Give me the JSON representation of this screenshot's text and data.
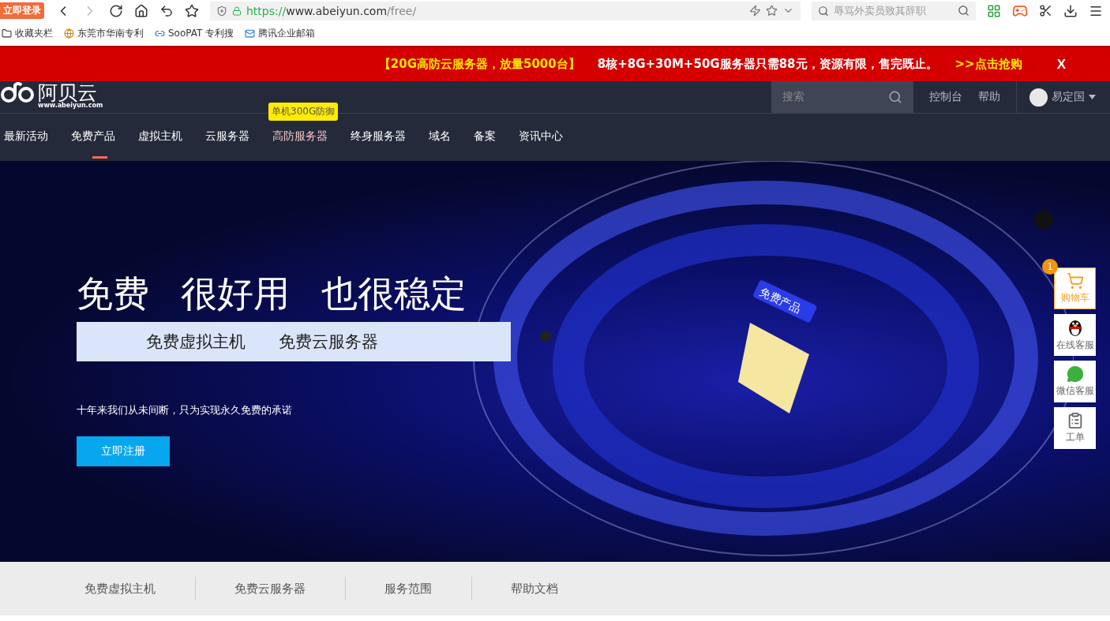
{
  "browser": {
    "login_badge": "立即登录",
    "url_scheme": "https://",
    "url_host": "www.abeiyun.com",
    "url_path": "/free/",
    "search_placeholder": "辱骂外卖员致其辞职",
    "bookmarks": [
      {
        "label": "收藏夹栏",
        "kind": "folder"
      },
      {
        "label": "东莞市华南专利",
        "kind": "site"
      },
      {
        "label": "SooPAT 专利搜",
        "kind": "link"
      },
      {
        "label": "腾讯企业邮箱",
        "kind": "mail"
      }
    ]
  },
  "promo": {
    "highlight": "【20G高防云服务器，放量5000台】",
    "text": "8核+8G+30M+50G服务器只需88元，资源有限，售完既止。",
    "link": ">>点击抢购",
    "close": "X"
  },
  "header": {
    "logo_text": "阿贝云",
    "logo_url": "www.abeiyun.com",
    "search_placeholder": "搜索",
    "links": [
      "控制台",
      "帮助"
    ],
    "user": "易定国"
  },
  "nav": [
    {
      "label": "最新活动",
      "selected": false
    },
    {
      "label": "免费产品",
      "selected": true
    },
    {
      "label": "虚拟主机",
      "selected": false
    },
    {
      "label": "云服务器",
      "selected": false
    },
    {
      "label": "高防服务器",
      "selected": false,
      "hovered": true,
      "tooltip": "单机300G防御"
    },
    {
      "label": "终身服务器",
      "selected": false
    },
    {
      "label": "域名",
      "selected": false
    },
    {
      "label": "备案",
      "selected": false
    },
    {
      "label": "资讯中心",
      "selected": false
    }
  ],
  "hero": {
    "headline": [
      "免费",
      "很好用",
      "也很稳定"
    ],
    "products": [
      "免费虚拟主机",
      "免费云服务器"
    ],
    "tagline": "十年来我们从未间断，只为实现永久免费的承诺",
    "cta": "立即注册",
    "art_label": "免费产品"
  },
  "side_tools": [
    {
      "kind": "cart",
      "label": "购物车",
      "badge": "1",
      "highlighted": true
    },
    {
      "kind": "qq",
      "label": "在线客服",
      "highlighted": false
    },
    {
      "kind": "wechat",
      "label": "微信客服",
      "highlighted": false
    },
    {
      "kind": "ticket",
      "label": "工单",
      "highlighted": false
    }
  ],
  "tabs": [
    {
      "label": "免费虚拟主机"
    },
    {
      "label": "免费云服务器"
    },
    {
      "label": "服务范围"
    },
    {
      "label": "帮助文档"
    }
  ]
}
